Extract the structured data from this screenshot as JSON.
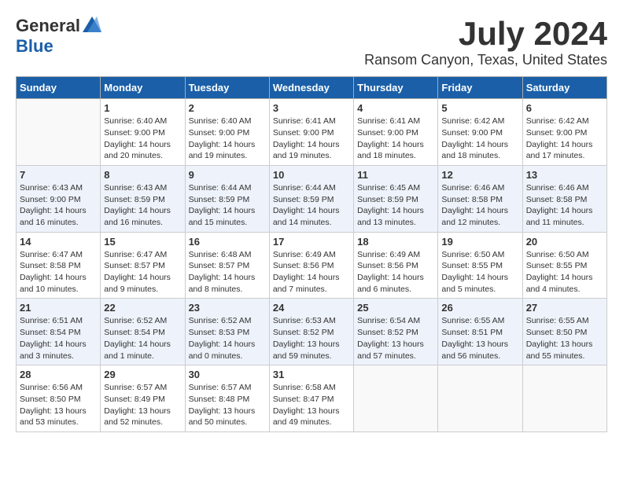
{
  "header": {
    "logo_general": "General",
    "logo_blue": "Blue",
    "month": "July 2024",
    "location": "Ransom Canyon, Texas, United States"
  },
  "weekdays": [
    "Sunday",
    "Monday",
    "Tuesday",
    "Wednesday",
    "Thursday",
    "Friday",
    "Saturday"
  ],
  "weeks": [
    [
      {
        "day": "",
        "info": ""
      },
      {
        "day": "1",
        "info": "Sunrise: 6:40 AM\nSunset: 9:00 PM\nDaylight: 14 hours\nand 20 minutes."
      },
      {
        "day": "2",
        "info": "Sunrise: 6:40 AM\nSunset: 9:00 PM\nDaylight: 14 hours\nand 19 minutes."
      },
      {
        "day": "3",
        "info": "Sunrise: 6:41 AM\nSunset: 9:00 PM\nDaylight: 14 hours\nand 19 minutes."
      },
      {
        "day": "4",
        "info": "Sunrise: 6:41 AM\nSunset: 9:00 PM\nDaylight: 14 hours\nand 18 minutes."
      },
      {
        "day": "5",
        "info": "Sunrise: 6:42 AM\nSunset: 9:00 PM\nDaylight: 14 hours\nand 18 minutes."
      },
      {
        "day": "6",
        "info": "Sunrise: 6:42 AM\nSunset: 9:00 PM\nDaylight: 14 hours\nand 17 minutes."
      }
    ],
    [
      {
        "day": "7",
        "info": "Sunrise: 6:43 AM\nSunset: 9:00 PM\nDaylight: 14 hours\nand 16 minutes."
      },
      {
        "day": "8",
        "info": "Sunrise: 6:43 AM\nSunset: 8:59 PM\nDaylight: 14 hours\nand 16 minutes."
      },
      {
        "day": "9",
        "info": "Sunrise: 6:44 AM\nSunset: 8:59 PM\nDaylight: 14 hours\nand 15 minutes."
      },
      {
        "day": "10",
        "info": "Sunrise: 6:44 AM\nSunset: 8:59 PM\nDaylight: 14 hours\nand 14 minutes."
      },
      {
        "day": "11",
        "info": "Sunrise: 6:45 AM\nSunset: 8:59 PM\nDaylight: 14 hours\nand 13 minutes."
      },
      {
        "day": "12",
        "info": "Sunrise: 6:46 AM\nSunset: 8:58 PM\nDaylight: 14 hours\nand 12 minutes."
      },
      {
        "day": "13",
        "info": "Sunrise: 6:46 AM\nSunset: 8:58 PM\nDaylight: 14 hours\nand 11 minutes."
      }
    ],
    [
      {
        "day": "14",
        "info": "Sunrise: 6:47 AM\nSunset: 8:58 PM\nDaylight: 14 hours\nand 10 minutes."
      },
      {
        "day": "15",
        "info": "Sunrise: 6:47 AM\nSunset: 8:57 PM\nDaylight: 14 hours\nand 9 minutes."
      },
      {
        "day": "16",
        "info": "Sunrise: 6:48 AM\nSunset: 8:57 PM\nDaylight: 14 hours\nand 8 minutes."
      },
      {
        "day": "17",
        "info": "Sunrise: 6:49 AM\nSunset: 8:56 PM\nDaylight: 14 hours\nand 7 minutes."
      },
      {
        "day": "18",
        "info": "Sunrise: 6:49 AM\nSunset: 8:56 PM\nDaylight: 14 hours\nand 6 minutes."
      },
      {
        "day": "19",
        "info": "Sunrise: 6:50 AM\nSunset: 8:55 PM\nDaylight: 14 hours\nand 5 minutes."
      },
      {
        "day": "20",
        "info": "Sunrise: 6:50 AM\nSunset: 8:55 PM\nDaylight: 14 hours\nand 4 minutes."
      }
    ],
    [
      {
        "day": "21",
        "info": "Sunrise: 6:51 AM\nSunset: 8:54 PM\nDaylight: 14 hours\nand 3 minutes."
      },
      {
        "day": "22",
        "info": "Sunrise: 6:52 AM\nSunset: 8:54 PM\nDaylight: 14 hours\nand 1 minute."
      },
      {
        "day": "23",
        "info": "Sunrise: 6:52 AM\nSunset: 8:53 PM\nDaylight: 14 hours\nand 0 minutes."
      },
      {
        "day": "24",
        "info": "Sunrise: 6:53 AM\nSunset: 8:52 PM\nDaylight: 13 hours\nand 59 minutes."
      },
      {
        "day": "25",
        "info": "Sunrise: 6:54 AM\nSunset: 8:52 PM\nDaylight: 13 hours\nand 57 minutes."
      },
      {
        "day": "26",
        "info": "Sunrise: 6:55 AM\nSunset: 8:51 PM\nDaylight: 13 hours\nand 56 minutes."
      },
      {
        "day": "27",
        "info": "Sunrise: 6:55 AM\nSunset: 8:50 PM\nDaylight: 13 hours\nand 55 minutes."
      }
    ],
    [
      {
        "day": "28",
        "info": "Sunrise: 6:56 AM\nSunset: 8:50 PM\nDaylight: 13 hours\nand 53 minutes."
      },
      {
        "day": "29",
        "info": "Sunrise: 6:57 AM\nSunset: 8:49 PM\nDaylight: 13 hours\nand 52 minutes."
      },
      {
        "day": "30",
        "info": "Sunrise: 6:57 AM\nSunset: 8:48 PM\nDaylight: 13 hours\nand 50 minutes."
      },
      {
        "day": "31",
        "info": "Sunrise: 6:58 AM\nSunset: 8:47 PM\nDaylight: 13 hours\nand 49 minutes."
      },
      {
        "day": "",
        "info": ""
      },
      {
        "day": "",
        "info": ""
      },
      {
        "day": "",
        "info": ""
      }
    ]
  ]
}
